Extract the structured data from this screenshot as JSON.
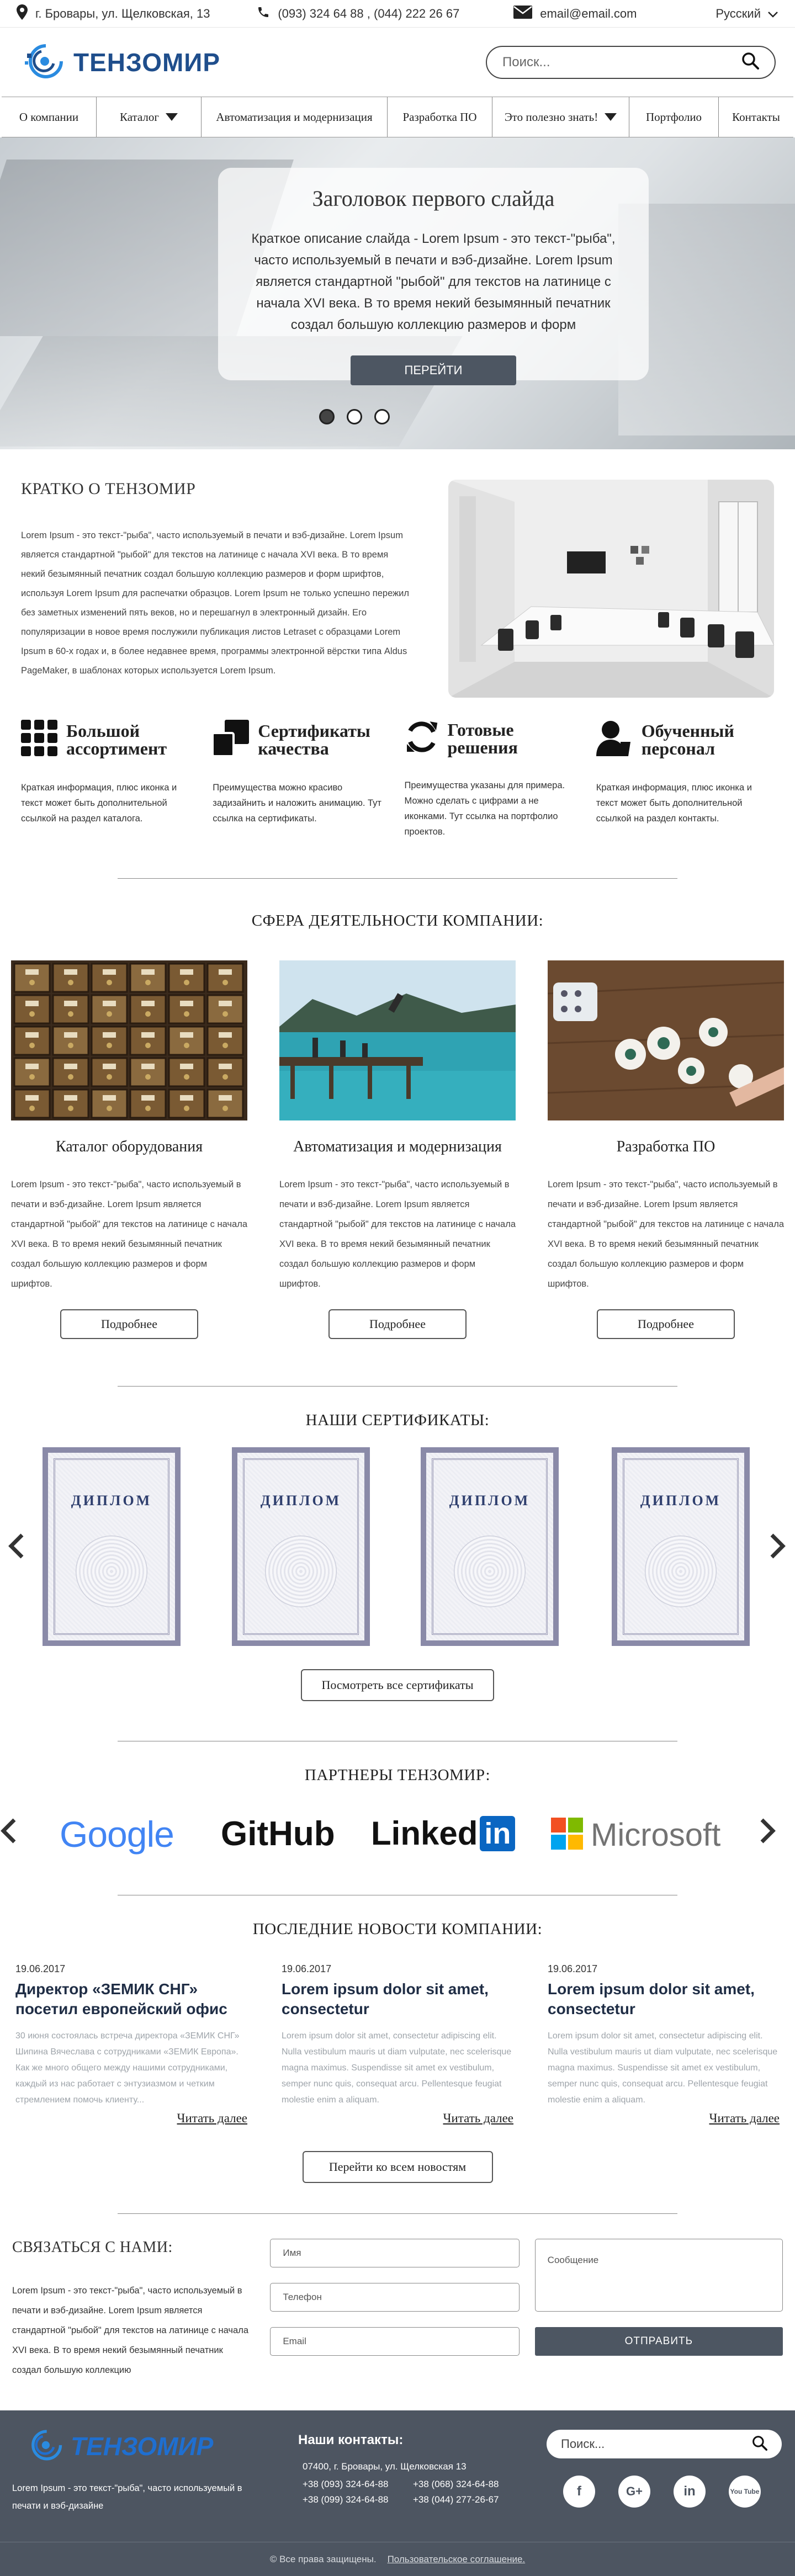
{
  "topbar": {
    "address": "г. Бровары, ул. Щелковская, 13",
    "phones": "(093) 324 64 88 , (044) 222 26 67",
    "email": "email@email.com",
    "language": "Русский"
  },
  "header": {
    "logo_text": "ТЕНЗОМИР",
    "search_placeholder": "Поиск..."
  },
  "nav": {
    "items": [
      {
        "label": "О компании"
      },
      {
        "label": "Каталог"
      },
      {
        "label": "Автоматизация и модернизация"
      },
      {
        "label": "Разработка ПО"
      },
      {
        "label": "Это полезно знать!"
      },
      {
        "label": "Портфолио"
      },
      {
        "label": "Контакты"
      }
    ]
  },
  "hero": {
    "title": "Заголовок первого слайда",
    "text": "Краткое описание слайда - Lorem Ipsum - это текст-\"рыба\", часто используемый в печати и вэб-дизайне. Lorem Ipsum является стандартной \"рыбой\" для текстов на латинице с начала XVI века. В то время некий безымянный печатник создал большую коллекцию размеров и форм",
    "button": "ПЕРЕЙТИ",
    "active_slide": 1,
    "slide_count": 3
  },
  "about": {
    "title": "КРАТКО О ТЕНЗОМИР",
    "text": "Lorem Ipsum - это текст-\"рыба\", часто используемый в печати и вэб-дизайне. Lorem Ipsum является стандартной \"рыбой\" для текстов на латинице с начала XVI века. В то время некий безымянный печатник создал большую коллекцию размеров и форм шрифтов, используя Lorem Ipsum для распечатки образцов. Lorem Ipsum не только успешно пережил без заметных изменений пять веков, но и перешагнул в электронный дизайн. Его популяризации в новое время послужили публикация листов Letraset с образцами Lorem Ipsum в 60-х годах и, в более недавнее время, программы электронной вёрстки типа Aldus PageMaker, в шаблонах которых используется Lorem Ipsum."
  },
  "features": [
    {
      "title": "Большой ассортимент",
      "text": "Краткая информация, плюс иконка и текст может быть дополнительной ссылкой на раздел каталога.",
      "icon": "grid-icon"
    },
    {
      "title": "Сертификаты качества",
      "text": "Преимущества можно красиво задизайнить и наложить анимацию. Тут ссылка на сертификаты.",
      "icon": "certificate-icon"
    },
    {
      "title": "Готовые решения",
      "text": "Преимущества указаны для примера. Можно сделать с цифрами а не иконками. Тут ссылка на портфолио проектов.",
      "icon": "refresh-icon"
    },
    {
      "title": "Обученный персонал",
      "text": "Краткая информация, плюс иконка и текст может быть дополнительной ссылкой на раздел контакты.",
      "icon": "staff-icon"
    }
  ],
  "spheres": {
    "title": "СФЕРА ДЕЯТЕЛЬНОСТИ КОМПАНИИ:",
    "items": [
      {
        "title": "Каталог оборудования",
        "text": "Lorem Ipsum - это текст-\"рыба\", часто используемый в печати и вэб-дизайне. Lorem Ipsum является стандартной \"рыбой\" для текстов на латинице с начала XVI века. В то время некий безымянный печатник создал большую коллекцию размеров и форм шрифтов.",
        "button": "Подробнее"
      },
      {
        "title": "Автоматизация и модернизация",
        "text": "Lorem Ipsum - это текст-\"рыба\", часто используемый в печати и вэб-дизайне. Lorem Ipsum является стандартной \"рыбой\" для текстов на латинице с начала XVI века. В то время некий безымянный печатник создал большую коллекцию размеров и форм шрифтов.",
        "button": "Подробнее"
      },
      {
        "title": "Разработка ПО",
        "text": "Lorem Ipsum - это текст-\"рыба\", часто используемый в печати и вэб-дизайне. Lorem Ipsum является стандартной \"рыбой\" для текстов на латинице с начала XVI века. В то время некий безымянный печатник создал большую коллекцию размеров и форм шрифтов.",
        "button": "Подробнее"
      }
    ]
  },
  "certificates": {
    "title": "НАШИ СЕРТИФИКАТЫ:",
    "items": [
      {
        "label": "ДИПЛОМ"
      },
      {
        "label": "ДИПЛОМ"
      },
      {
        "label": "ДИПЛОМ"
      },
      {
        "label": "ДИПЛОМ"
      }
    ],
    "button": "Посмотреть все сертификаты"
  },
  "partners": {
    "title": "ПАРТНЕРЫ ТЕНЗОМИР:",
    "logos": {
      "google": "Google",
      "github": "GitHub",
      "linkedin_word": "Linked",
      "linkedin_in": "in",
      "microsoft": "Microsoft"
    }
  },
  "news": {
    "title": "ПОСЛЕДНИЕ НОВОСТИ КОМПАНИИ:",
    "items": [
      {
        "date": "19.06.2017",
        "title": "Директор «ЗЕМИК СНГ» посетил европейский офис",
        "text": "30 июня состоялась встреча директора «ЗЕМИК СНГ» Шипина Вячеслава с сотрудниками «ЗЕМИК Европа». Как же много общего между нашими сотрудниками, каждый из нас работает с энтузиазмом и четким стремлением помочь клиенту...",
        "more": "Читать далее"
      },
      {
        "date": "19.06.2017",
        "title": "Lorem ipsum dolor sit amet, consectetur",
        "text": "Lorem ipsum dolor sit amet, consectetur adipiscing elit. Nulla vestibulum mauris ut diam vulputate, nec scelerisque magna maximus. Suspendisse sit amet ex vestibulum, semper nunc quis, consequat arcu. Pellentesque feugiat molestie enim a aliquam.",
        "more": "Читать далее"
      },
      {
        "date": "19.06.2017",
        "title": "Lorem ipsum dolor sit amet, consectetur",
        "text": "Lorem ipsum dolor sit amet, consectetur adipiscing elit. Nulla vestibulum mauris ut diam vulputate, nec scelerisque magna maximus. Suspendisse sit amet ex vestibulum, semper nunc quis, consequat arcu. Pellentesque feugiat molestie enim a aliquam.",
        "more": "Читать далее"
      }
    ],
    "button": "Перейти ко всем новостям"
  },
  "contact": {
    "title": "СВЯЗАТЬСЯ С НАМИ:",
    "text": "Lorem Ipsum - это текст-\"рыба\", часто используемый в печати и вэб-дизайне. Lorem Ipsum является стандартной \"рыбой\" для текстов на латинице с начала XVI века. В то время некий безымянный печатник создал большую коллекцию",
    "name_placeholder": "Имя",
    "phone_placeholder": "Телефон",
    "email_placeholder": "Email",
    "message_placeholder": "Сообщение",
    "send": "ОТПРАВИТЬ"
  },
  "footer": {
    "logo_text": "ТЕНЗОМИР",
    "tagline": "Lorem Ipsum - это текст-\"рыба\", часто используемый в печати и вэб-дизайне",
    "contacts_title": "Наши контакты:",
    "address": "07400, г. Бровары, ул. Щелковская 13",
    "phones": [
      "+38 (093) 324-64-88",
      "+38 (068) 324-64-88",
      "+38 (099) 324-64-88",
      "+38 (044) 277-26-67"
    ],
    "search_placeholder": "Поиск...",
    "socials": [
      {
        "icon": "facebook-icon",
        "label": "f"
      },
      {
        "icon": "google-plus-icon",
        "label": "G+"
      },
      {
        "icon": "linkedin-icon",
        "label": "in"
      },
      {
        "icon": "youtube-icon",
        "label": "You Tube"
      }
    ],
    "copyright": "© Все права защищены.",
    "agreement": "Пользовательское соглашение."
  },
  "colors": {
    "accent_dark": "#4d5662",
    "logo_blue": "#1f4e8c",
    "footer_bg": "#4d5561"
  }
}
